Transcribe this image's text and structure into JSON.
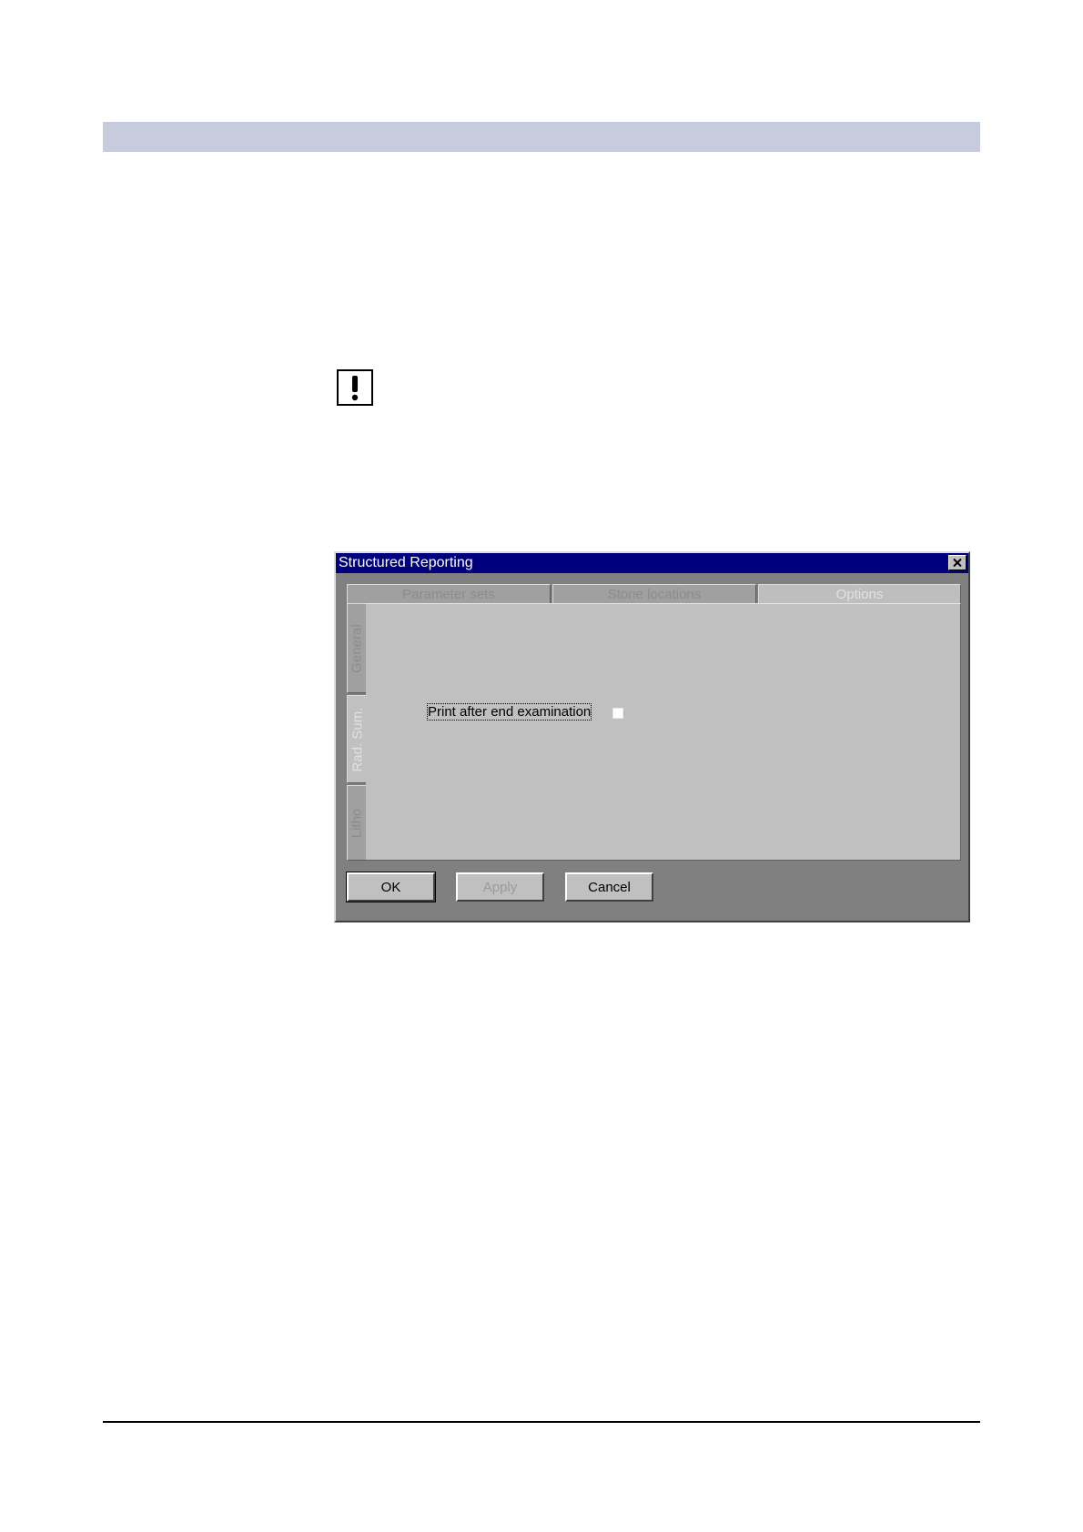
{
  "dialog": {
    "title": "Structured Reporting",
    "close_icon": "close-icon",
    "top_tabs": [
      {
        "label": "Parameter sets",
        "active": false
      },
      {
        "label": "Stone locations",
        "active": false
      },
      {
        "label": "Options",
        "active": true
      }
    ],
    "side_tabs": [
      {
        "label": "General",
        "active": false
      },
      {
        "label": "Rad. Sum.",
        "active": true
      },
      {
        "label": "Litho",
        "active": false
      }
    ],
    "options": {
      "print_after_end_label": "Print after end examination",
      "print_after_end_checked": false
    },
    "buttons": {
      "ok": "OK",
      "apply": "Apply",
      "cancel": "Cancel"
    }
  },
  "note_icon": "exclamation-icon",
  "colors": {
    "header_band": "#c6ccde",
    "title_bar": "#00007f",
    "dialog_bg": "#808080",
    "panel_bg": "#c0c0c0"
  }
}
